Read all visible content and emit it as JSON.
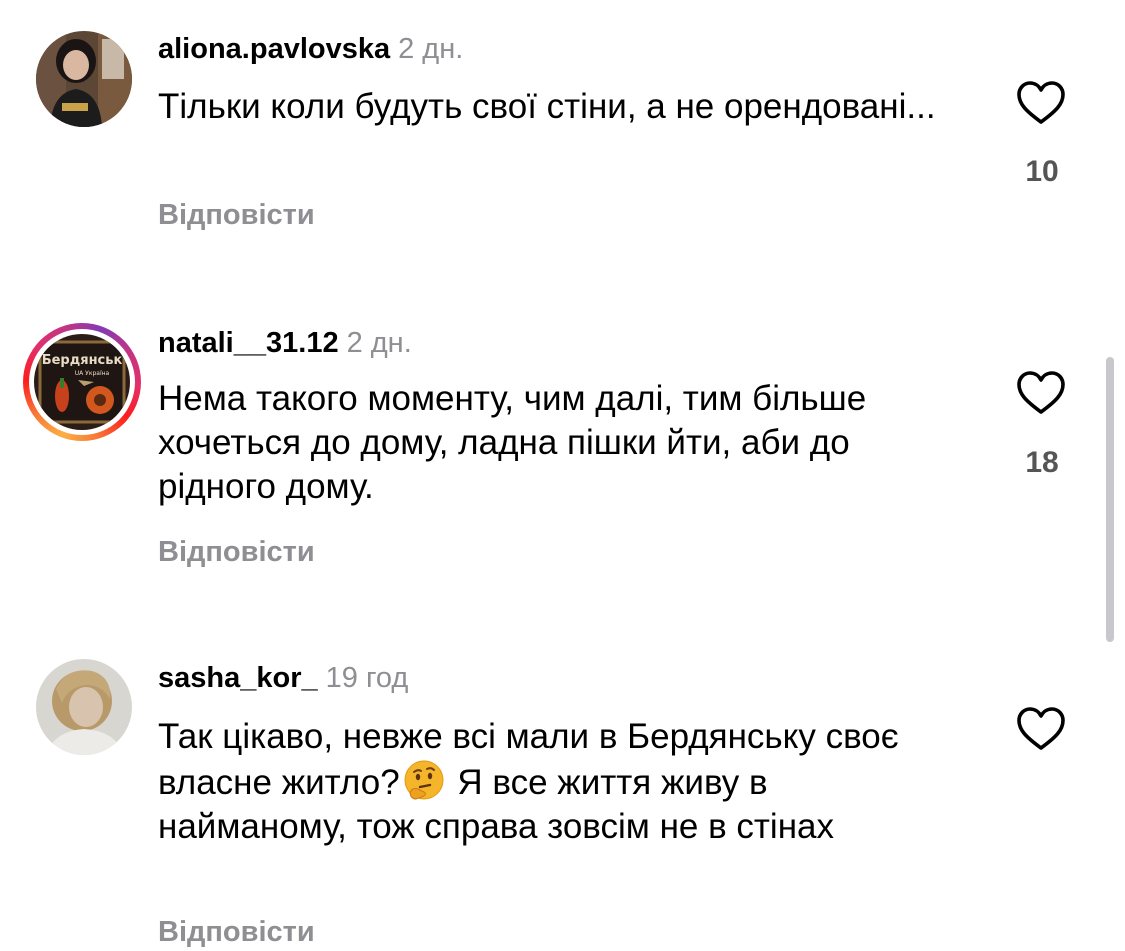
{
  "comments": [
    {
      "username": "aliona.pavlovska",
      "time": "2 дн.",
      "text": "Тільки коли будуть свої стіни, а не орендовані...",
      "reply_label": "Відповісти",
      "likes": "10",
      "avatar_ring": false
    },
    {
      "username": "natali__31.12",
      "time": "2 дн.",
      "text": "Нема такого моменту, чим далі, тим більше хочеться до дому, ладна пішки йти, аби до рідного дому.",
      "reply_label": "Відповісти",
      "likes": "18",
      "avatar_ring": true,
      "avatar_text": "Бердянськ",
      "avatar_subtext": "UA Україна"
    },
    {
      "username": "sasha_kor_",
      "time": "19 год",
      "text_part1": "Так цікаво, невже всі мали в Бердянську своє власне житло?",
      "emoji": "thinking-face",
      "text_part2": " Я все життя живу в найманому, тож справа зовсім не в стінах",
      "reply_label": "Відповісти",
      "avatar_ring": false
    }
  ],
  "icons": {
    "heart": "heart-outline-icon"
  },
  "colors": {
    "secondary_text": "#8e8e93",
    "likes_text": "#555555",
    "story_ring": [
      "#fcaf45",
      "#fd1d1d",
      "#c13584",
      "#833ab4"
    ]
  }
}
